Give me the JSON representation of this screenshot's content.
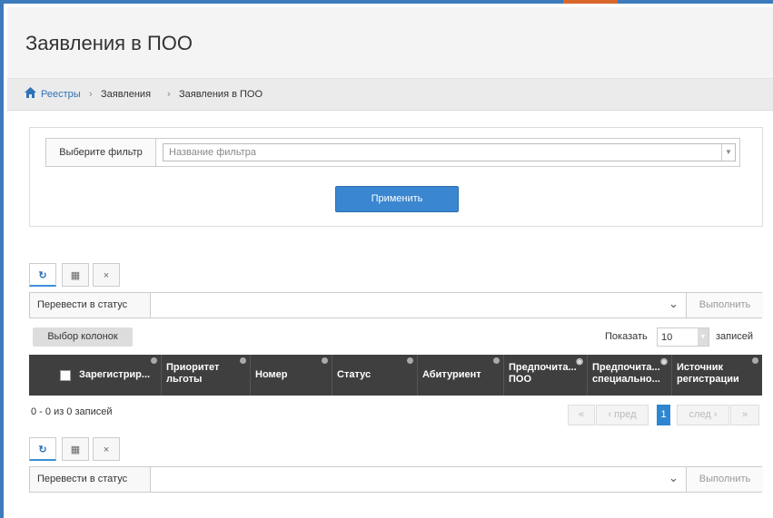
{
  "page": {
    "title": "Заявления в ПОО"
  },
  "breadcrumb": {
    "items": [
      "Реестры",
      "Заявления",
      "Заявления в ПОО"
    ],
    "separator": "›"
  },
  "filter": {
    "label": "Выберите фильтр",
    "placeholder": "Название фильтра",
    "apply_label": "Применить"
  },
  "toolbar": {
    "refresh_icon": "↻",
    "columns_icon": "▦",
    "clear_icon": "×"
  },
  "status_action": {
    "label": "Перевести в статус",
    "execute_label": "Выполнить",
    "chevron": "⌄"
  },
  "grid": {
    "column_choice_label": "Выбор колонок",
    "show_label": "Показать",
    "page_size": "10",
    "records_label": "записей",
    "columns": [
      {
        "label": "Зарегистрир..."
      },
      {
        "label": "Приоритет льготы"
      },
      {
        "label": "Номер"
      },
      {
        "label": "Статус"
      },
      {
        "label": "Абитуриент"
      },
      {
        "label": "Предпочита... ПОО"
      },
      {
        "label": "Предпочита... специально..."
      },
      {
        "label": "Источник регистрации"
      }
    ],
    "summary": "0 - 0 из 0 записей",
    "pager": {
      "first": "«",
      "prev": "‹ пред",
      "current": "1",
      "next": "след ›",
      "last": "»"
    }
  },
  "colors": {
    "accent": "#3d7bbd",
    "primary_button": "#3a86d0",
    "grid_header": "#3f3f3f"
  }
}
